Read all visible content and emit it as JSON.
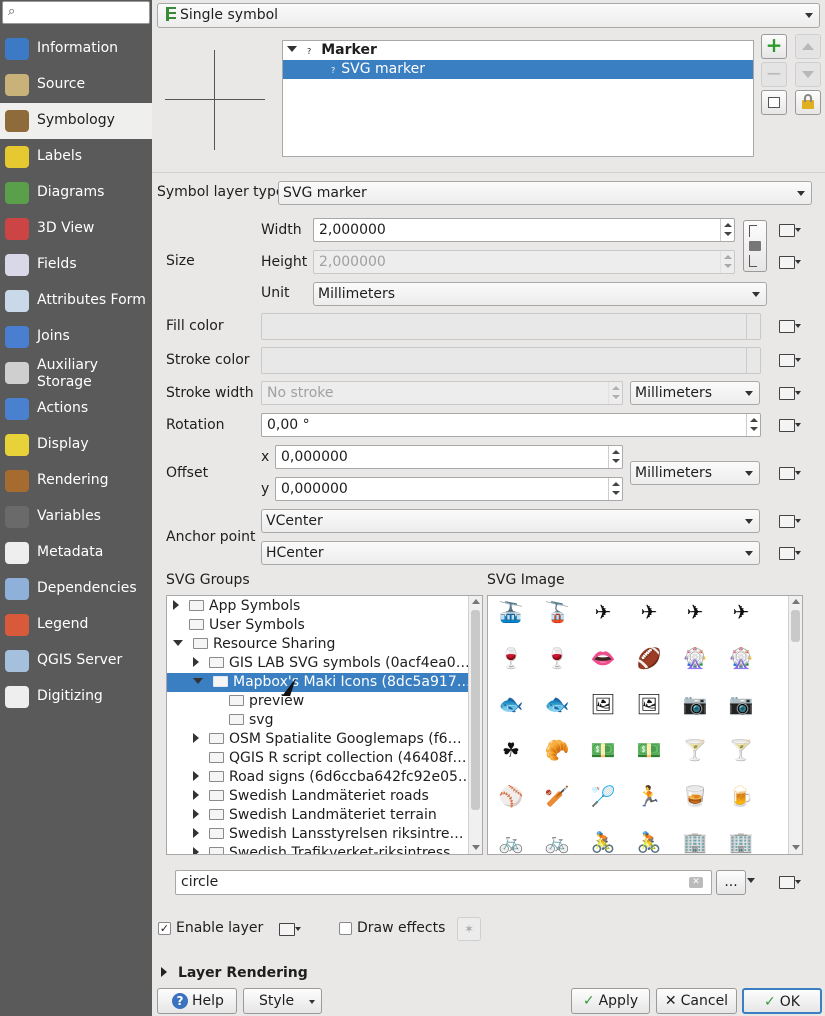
{
  "sidebar": {
    "search_placeholder": "",
    "items": [
      {
        "label": "Information",
        "icon": "info-icon",
        "color": "#3d7ac5"
      },
      {
        "label": "Source",
        "icon": "source-gear-icon",
        "color": "#c9b27a"
      },
      {
        "label": "Symbology",
        "icon": "paintbrush-icon",
        "color": "#8f6a3a"
      },
      {
        "label": "Labels",
        "icon": "abc-label-icon",
        "color": "#e6c830"
      },
      {
        "label": "Diagrams",
        "icon": "diagrams-icon",
        "color": "#5aa04a"
      },
      {
        "label": "3D View",
        "icon": "cube-3d-icon",
        "color": "#c44"
      },
      {
        "label": "Fields",
        "icon": "fields-table-icon",
        "color": "#d8d8e8"
      },
      {
        "label": "Attributes Form",
        "icon": "attributes-form-icon",
        "color": "#c9d9ea"
      },
      {
        "label": "Joins",
        "icon": "joins-icon",
        "color": "#4a7ed0"
      },
      {
        "label": "Auxiliary Storage",
        "icon": "database-icon",
        "color": "#cfcfcf"
      },
      {
        "label": "Actions",
        "icon": "actions-gear-icon",
        "color": "#4a80d0"
      },
      {
        "label": "Display",
        "icon": "speech-bubble-icon",
        "color": "#e8d23a"
      },
      {
        "label": "Rendering",
        "icon": "brush-icon",
        "color": "#a66b2e"
      },
      {
        "label": "Variables",
        "icon": "epsilon-icon",
        "color": "#6a6a6a"
      },
      {
        "label": "Metadata",
        "icon": "metadata-icon",
        "color": "#eee"
      },
      {
        "label": "Dependencies",
        "icon": "dependencies-icon",
        "color": "#8fb0d8"
      },
      {
        "label": "Legend",
        "icon": "legend-icon",
        "color": "#d85a3a"
      },
      {
        "label": "QGIS Server",
        "icon": "server-icon",
        "color": "#a5c0dc"
      },
      {
        "label": "Digitizing",
        "icon": "digitizing-icon",
        "color": "#eee"
      }
    ]
  },
  "renderer": {
    "value": "Single symbol"
  },
  "symbol_tree": {
    "root": "Marker",
    "child": "SVG marker"
  },
  "symbol_layer_type": {
    "label": "Symbol layer type",
    "value": "SVG marker"
  },
  "size": {
    "label": "Size",
    "width_label": "Width",
    "width": "2,000000",
    "height_label": "Height",
    "height": "2,000000",
    "unit_label": "Unit",
    "unit": "Millimeters"
  },
  "fill_color": {
    "label": "Fill color"
  },
  "stroke_color": {
    "label": "Stroke color"
  },
  "stroke_width": {
    "label": "Stroke width",
    "value": "No stroke",
    "unit": "Millimeters"
  },
  "rotation": {
    "label": "Rotation",
    "value": "0,00 °"
  },
  "offset": {
    "label": "Offset",
    "x_label": "x",
    "x": "0,000000",
    "y_label": "y",
    "y": "0,000000",
    "unit": "Millimeters"
  },
  "anchor": {
    "label": "Anchor point",
    "v": "VCenter",
    "h": "HCenter"
  },
  "svg_groups": {
    "label": "SVG Groups",
    "rows": [
      {
        "text": "App Symbols",
        "indent": 0,
        "exp": "r"
      },
      {
        "text": "User Symbols",
        "indent": 0,
        "exp": ""
      },
      {
        "text": "Resource Sharing",
        "indent": 0,
        "exp": "d"
      },
      {
        "text": "GIS LAB SVG symbols (0acf4ea0…",
        "indent": 1,
        "exp": "r"
      },
      {
        "text": "Mapbox's Maki Icons (8dc5a917…",
        "indent": 1,
        "exp": "d",
        "sel": true
      },
      {
        "text": "preview",
        "indent": 2,
        "exp": ""
      },
      {
        "text": "svg",
        "indent": 2,
        "exp": ""
      },
      {
        "text": "OSM Spatialite Googlemaps (f6…",
        "indent": 1,
        "exp": "r"
      },
      {
        "text": "QGIS R script collection (46408f…",
        "indent": 1,
        "exp": ""
      },
      {
        "text": "Road signs (6d6ccba642fc92e05…",
        "indent": 1,
        "exp": "r"
      },
      {
        "text": "Swedish Landmäteriet roads",
        "indent": 1,
        "exp": "r"
      },
      {
        "text": "Swedish Landmäteriet terrain",
        "indent": 1,
        "exp": "r"
      },
      {
        "text": "Swedish Lansstyrelsen riksintre…",
        "indent": 1,
        "exp": "r"
      },
      {
        "text": "Swedish Trafikverket-riksintress…",
        "indent": 1,
        "exp": "r"
      }
    ]
  },
  "svg_image": {
    "label": "SVG Image",
    "rows": [
      [
        {
          "g": "🚠",
          "n": "aerialway-icon"
        },
        {
          "g": "🚡",
          "n": "aerialway-large-icon"
        },
        {
          "g": "✈",
          "n": "airfield-icon"
        },
        {
          "g": "✈",
          "n": "airfield-large-icon"
        },
        {
          "g": "✈",
          "n": "airport-icon"
        },
        {
          "g": "✈",
          "n": "airport-large-icon"
        }
      ],
      [
        {
          "g": "🍷",
          "n": "alcohol-shop-icon"
        },
        {
          "g": "🍷",
          "n": "alcohol-shop-large-icon"
        },
        {
          "g": "👄",
          "n": "america-football-icon"
        },
        {
          "g": "🏈",
          "n": "america-football-large-icon"
        },
        {
          "g": "🎡",
          "n": "amusement-park-icon"
        },
        {
          "g": "🎡",
          "n": "amusement-park-large-icon"
        }
      ],
      [
        {
          "g": "🐟",
          "n": "aquarium-icon"
        },
        {
          "g": "🐟",
          "n": "aquarium-large-icon"
        },
        {
          "g": "🖼",
          "n": "art-gallery-icon"
        },
        {
          "g": "🖼",
          "n": "art-gallery-large-icon"
        },
        {
          "g": "📷",
          "n": "attraction-icon"
        },
        {
          "g": "📷",
          "n": "attraction-large-icon"
        }
      ],
      [
        {
          "g": "☘",
          "n": "bakery-icon"
        },
        {
          "g": "🥐",
          "n": "bakery-large-icon"
        },
        {
          "g": "💵",
          "n": "bank-icon"
        },
        {
          "g": "💵",
          "n": "bank-large-icon"
        },
        {
          "g": "🍸",
          "n": "bar-icon"
        },
        {
          "g": "🍸",
          "n": "bar-large-icon"
        }
      ],
      [
        {
          "g": "⚾",
          "n": "baseball-icon"
        },
        {
          "g": "🏏",
          "n": "cricket-icon"
        },
        {
          "g": "🏸",
          "n": "badminton-icon"
        },
        {
          "g": "🏃",
          "n": "sport-icon"
        },
        {
          "g": "🥃",
          "n": "beer-icon"
        },
        {
          "g": "🍺",
          "n": "beer-large-icon"
        }
      ],
      [
        {
          "g": "🚲",
          "n": "bicycle-icon"
        },
        {
          "g": "🚲",
          "n": "bicycle-large-icon"
        },
        {
          "g": "🚴",
          "n": "cycling-icon"
        },
        {
          "g": "🚴",
          "n": "cycling-large-icon"
        },
        {
          "g": "🏢",
          "n": "building-icon"
        },
        {
          "g": "🏢",
          "n": "building-large-icon"
        }
      ]
    ]
  },
  "search": {
    "value": "circle",
    "more": "..."
  },
  "enable_layer": {
    "label": "Enable layer",
    "checked": "✓"
  },
  "draw_effects": {
    "label": "Draw effects"
  },
  "layer_rendering": {
    "label": "Layer Rendering"
  },
  "buttons": {
    "help": "Help",
    "style": "Style",
    "apply": "Apply",
    "cancel": "Cancel",
    "ok": "OK"
  }
}
